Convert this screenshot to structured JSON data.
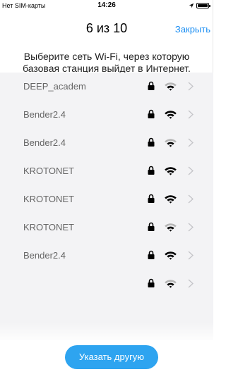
{
  "status_bar": {
    "carrier": "Нет SIM-карты",
    "time": "14:26",
    "icons": [
      "location-arrow-icon",
      "battery-icon"
    ]
  },
  "nav": {
    "title": "6 из 10",
    "close_label": "Закрыть"
  },
  "instruction": "Выберите сеть Wi-Fi, через которую базовая станция выйдет в Интернет.",
  "networks": [
    {
      "ssid": "DEEP_academ",
      "secured": true,
      "signal_level": 2,
      "signal_max": 3
    },
    {
      "ssid": "Bender2.4",
      "secured": true,
      "signal_level": 3,
      "signal_max": 3
    },
    {
      "ssid": "Bender2.4",
      "secured": true,
      "signal_level": 2,
      "signal_max": 3
    },
    {
      "ssid": "KROTONET",
      "secured": true,
      "signal_level": 3,
      "signal_max": 3
    },
    {
      "ssid": "KROTONET",
      "secured": true,
      "signal_level": 3,
      "signal_max": 3
    },
    {
      "ssid": "KROTONET",
      "secured": true,
      "signal_level": 2,
      "signal_max": 3
    },
    {
      "ssid": "Bender2.4",
      "secured": true,
      "signal_level": 3,
      "signal_max": 3
    },
    {
      "ssid": "",
      "secured": true,
      "signal_level": 2,
      "signal_max": 3
    }
  ],
  "other_button_label": "Указать другую",
  "colors": {
    "accent": "#1b8ef3",
    "button": "#2ea4f0",
    "list_bg": "#f3f3f5",
    "ssid_text": "#666666",
    "wifi_active": "#000000",
    "wifi_inactive": "#b5b5b5"
  }
}
